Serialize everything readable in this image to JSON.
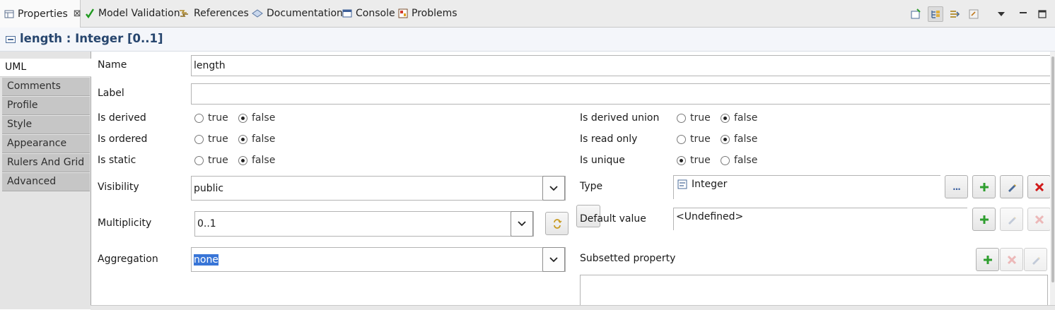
{
  "tabs": [
    {
      "label": "Properties",
      "icon": "properties-icon",
      "active": true
    },
    {
      "label": "Model Validation",
      "icon": "checkmark-icon"
    },
    {
      "label": "References",
      "icon": "references-icon"
    },
    {
      "label": "Documentation",
      "icon": "documentation-icon"
    },
    {
      "label": "Console",
      "icon": "console-icon"
    },
    {
      "label": "Problems",
      "icon": "problems-icon"
    }
  ],
  "toolbar_icons": [
    "new-view-icon",
    "show-categories-icon",
    "show-advanced-icon",
    "restore-default-icon",
    "view-menu-icon",
    "minimize-icon",
    "maximize-icon"
  ],
  "element_title": "length : Integer [0..1]",
  "left_tabs": [
    "UML",
    "Comments",
    "Profile",
    "Style",
    "Appearance",
    "Rulers And Grid",
    "Advanced"
  ],
  "form": {
    "name_label": "Name",
    "name_value": "length",
    "label_label": "Label",
    "label_value": "",
    "true_label": "true",
    "false_label": "false",
    "is_derived": {
      "label": "Is derived",
      "value": "false"
    },
    "is_ordered": {
      "label": "Is ordered",
      "value": "false"
    },
    "is_static": {
      "label": "Is static",
      "value": "false"
    },
    "is_derived_union": {
      "label": "Is derived union",
      "value": "false"
    },
    "is_read_only": {
      "label": "Is read only",
      "value": "false"
    },
    "is_unique": {
      "label": "Is unique",
      "value": "true"
    },
    "visibility_label": "Visibility",
    "visibility_value": "public",
    "multiplicity_label": "Multiplicity",
    "multiplicity_value": "0..1",
    "aggregation_label": "Aggregation",
    "aggregation_value": "none",
    "type_label": "Type",
    "type_value": "Integer",
    "default_value_label": "Default value",
    "default_value_value": "<Undefined>",
    "subsetted_property_label": "Subsetted property",
    "browse_button_label": "..."
  },
  "colors": {
    "title_text": "#27466e",
    "selection": "#3875d7",
    "add_green": "#2e9e2e",
    "delete_red": "#d01818"
  }
}
